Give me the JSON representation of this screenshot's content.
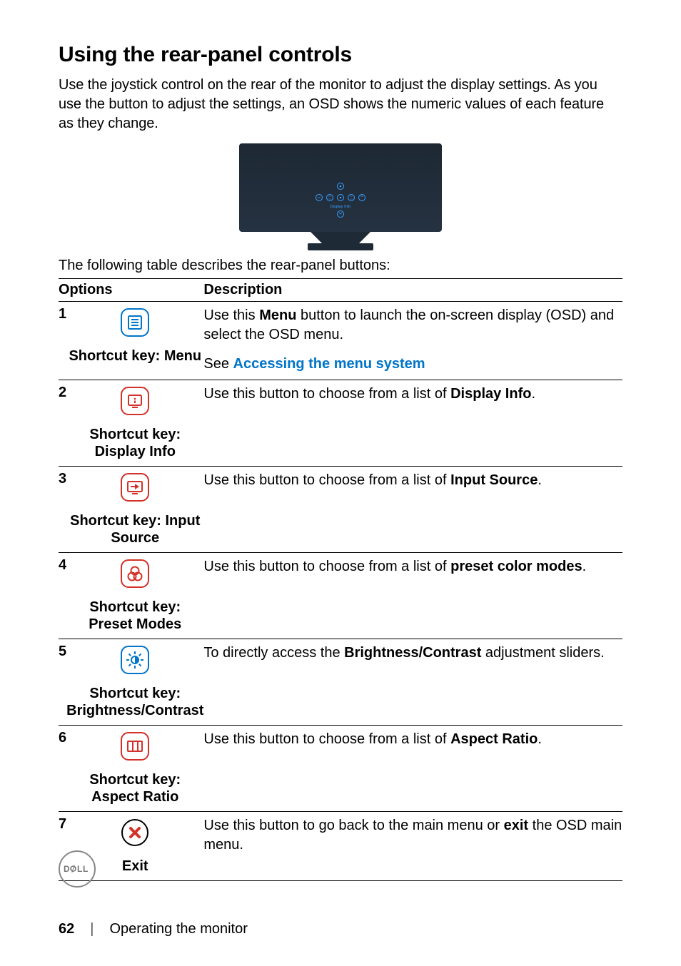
{
  "heading": "Using the rear-panel controls",
  "intro": "Use the joystick control on the rear of the monitor to adjust the display settings. As you use the button to adjust the settings, an OSD shows the numeric values of each feature as they change.",
  "osd_label": "Display Info",
  "table_intro": "The following table describes the rear-panel buttons:",
  "table": {
    "header_options": "Options",
    "header_description": "Description",
    "rows": [
      {
        "num": "1",
        "shortcut": "Shortcut key:  Menu",
        "desc_pre": "Use this ",
        "desc_bold": "Menu",
        "desc_post": " button to launch the on-screen display (OSD) and select the OSD menu.",
        "see_label": "See ",
        "see_link": "Accessing the menu system"
      },
      {
        "num": "2",
        "shortcut_l1": "Shortcut key:",
        "shortcut_l2": "Display Info",
        "desc_pre": "Use this button to choose from a list of ",
        "desc_bold": "Display Info",
        "desc_post": "."
      },
      {
        "num": "3",
        "shortcut_l1": "Shortcut key: Input",
        "shortcut_l2": "Source",
        "desc_pre": "Use this button to choose from a list of ",
        "desc_bold": "Input Source",
        "desc_post": "."
      },
      {
        "num": "4",
        "shortcut_l1": "Shortcut key:",
        "shortcut_l2": "Preset Modes",
        "desc_pre": "Use this button to choose from a list of ",
        "desc_bold": "preset color modes",
        "desc_post": "."
      },
      {
        "num": "5",
        "shortcut_l1": "Shortcut key:",
        "shortcut_l2": "Brightness/Contrast",
        "desc_pre": "To directly access the ",
        "desc_bold": "Brightness/Contrast",
        "desc_post": " adjustment sliders."
      },
      {
        "num": "6",
        "shortcut_l1": "Shortcut key:",
        "shortcut_l2": "Aspect Ratio",
        "desc_pre": "Use this button to choose from a list of ",
        "desc_bold": "Aspect Ratio",
        "desc_post": "."
      },
      {
        "num": "7",
        "shortcut": "Exit",
        "desc_pre": "Use this button to go back to the main menu or ",
        "desc_bold": "exit",
        "desc_post": " the OSD main menu."
      }
    ]
  },
  "dell": "D₠LL",
  "footer": {
    "page": "62",
    "sep": "|",
    "chapter": "Operating the monitor"
  }
}
